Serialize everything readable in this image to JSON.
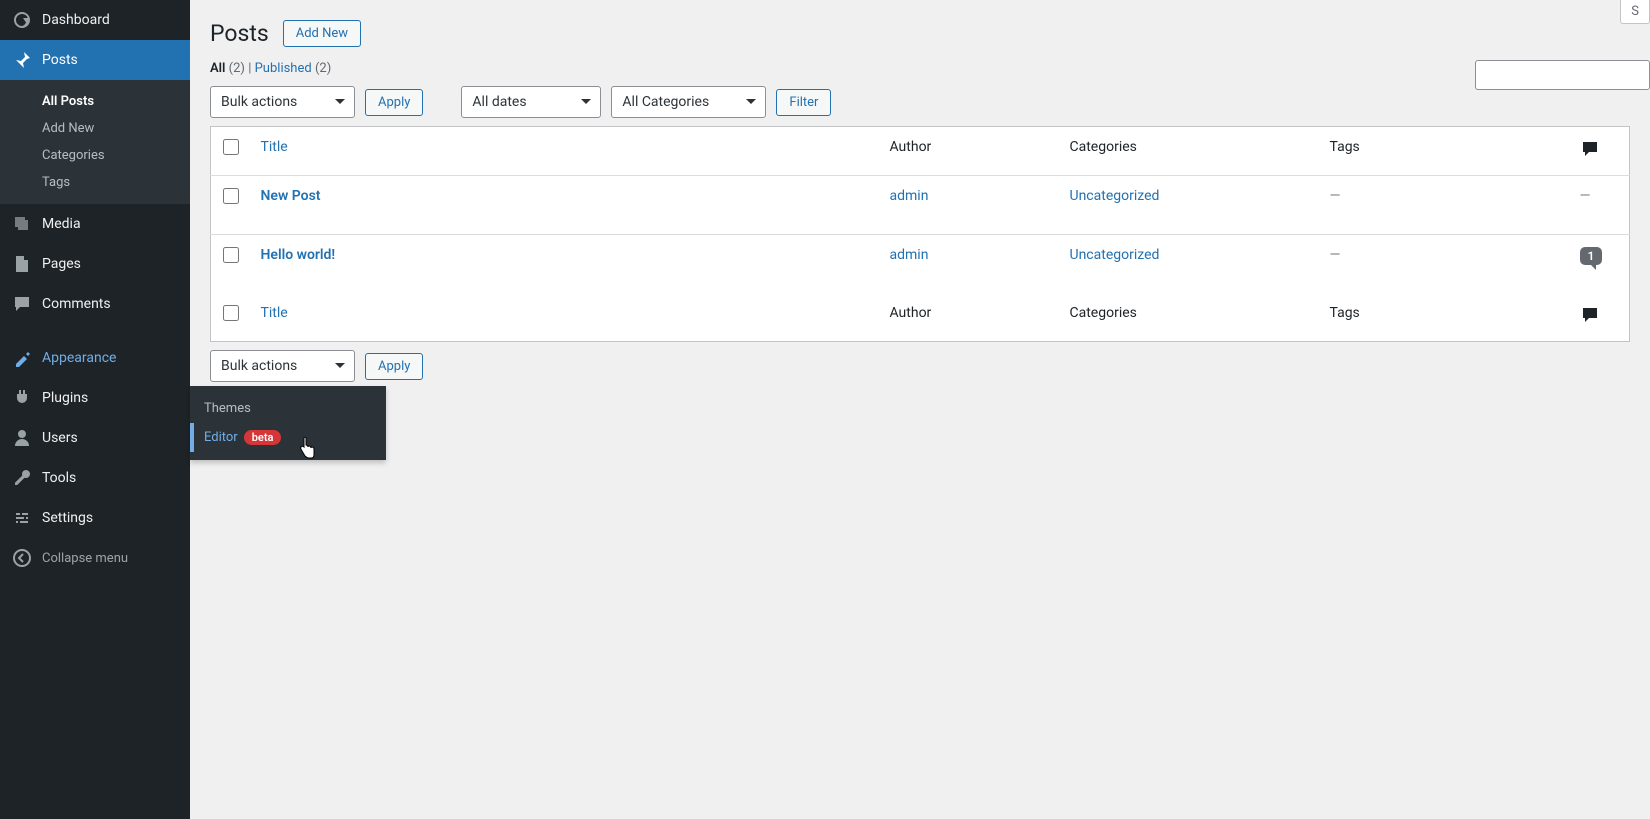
{
  "sidebar": {
    "dashboard": "Dashboard",
    "posts": "Posts",
    "posts_sub": {
      "all": "All Posts",
      "addnew": "Add New",
      "categories": "Categories",
      "tags": "Tags"
    },
    "media": "Media",
    "pages": "Pages",
    "comments": "Comments",
    "appearance": "Appearance",
    "appearance_sub": {
      "themes": "Themes",
      "editor": "Editor",
      "editor_badge": "beta"
    },
    "plugins": "Plugins",
    "users": "Users",
    "tools": "Tools",
    "settings": "Settings",
    "collapse": "Collapse menu"
  },
  "header": {
    "title": "Posts",
    "addnew": "Add New",
    "screen_options": "S"
  },
  "filters": {
    "all": "All",
    "all_count": "(2)",
    "sep": " | ",
    "published": "Published",
    "published_count": "(2)",
    "bulk": "Bulk actions",
    "apply": "Apply",
    "dates": "All dates",
    "categories": "All Categories",
    "filter": "Filter"
  },
  "columns": {
    "title": "Title",
    "author": "Author",
    "categories": "Categories",
    "tags": "Tags"
  },
  "rows": [
    {
      "title": "New Post",
      "author": "admin",
      "category": "Uncategorized",
      "tags": "—",
      "comments": "—"
    },
    {
      "title": "Hello world!",
      "author": "admin",
      "category": "Uncategorized",
      "tags": "—",
      "comments": "1"
    }
  ],
  "bottom": {
    "bulk": "Bulk actions",
    "apply": "Apply"
  }
}
